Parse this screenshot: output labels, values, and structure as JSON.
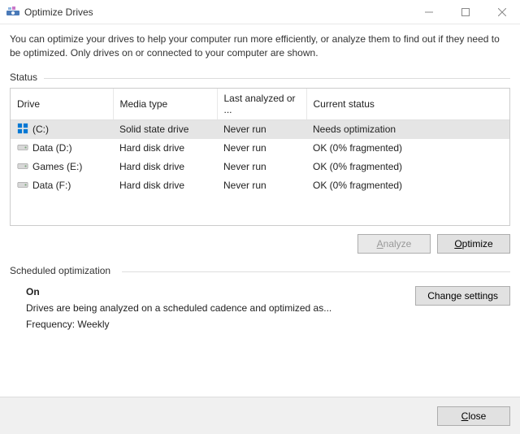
{
  "window": {
    "title": "Optimize Drives"
  },
  "description": "You can optimize your drives to help your computer run more efficiently, or analyze them to find out if they need to be optimized. Only drives on or connected to your computer are shown.",
  "status_label": "Status",
  "table": {
    "headers": {
      "drive": "Drive",
      "media": "Media type",
      "analyzed": "Last analyzed or ...",
      "status": "Current status"
    },
    "rows": [
      {
        "name": "(C:)",
        "icon": "windows",
        "media": "Solid state drive",
        "analyzed": "Never run",
        "status": "Needs optimization",
        "selected": true
      },
      {
        "name": "Data (D:)",
        "icon": "hdd",
        "media": "Hard disk drive",
        "analyzed": "Never run",
        "status": "OK (0% fragmented)",
        "selected": false
      },
      {
        "name": "Games (E:)",
        "icon": "hdd",
        "media": "Hard disk drive",
        "analyzed": "Never run",
        "status": "OK (0% fragmented)",
        "selected": false
      },
      {
        "name": "Data (F:)",
        "icon": "hdd",
        "media": "Hard disk drive",
        "analyzed": "Never run",
        "status": "OK (0% fragmented)",
        "selected": false
      }
    ]
  },
  "buttons": {
    "analyze": "Analyze",
    "optimize": "Optimize",
    "change_settings": "Change settings",
    "close": "Close"
  },
  "scheduled": {
    "label": "Scheduled optimization",
    "state": "On",
    "description": "Drives are being analyzed on a scheduled cadence and optimized as...",
    "frequency_label": "Frequency:",
    "frequency_value": "Weekly"
  }
}
